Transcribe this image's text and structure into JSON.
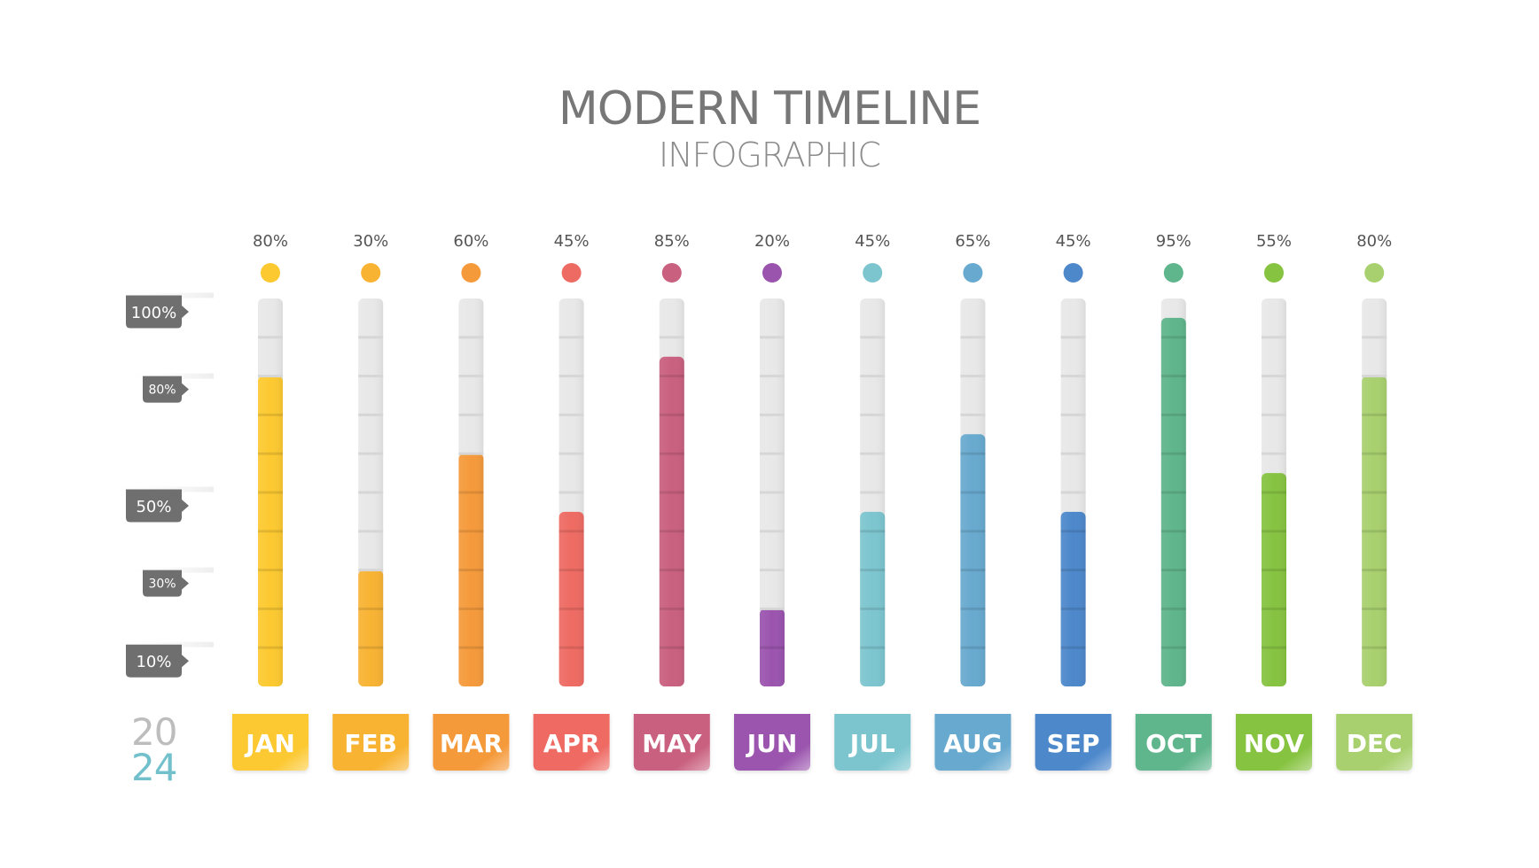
{
  "header": {
    "title": "MODERN TIMELINE",
    "subtitle": "INFOGRAPHIC"
  },
  "year": {
    "top": "20",
    "bottom": "24",
    "top_color": "#bdbdbd",
    "bottom_color": "#72c0cc"
  },
  "chart_data": {
    "type": "bar",
    "title": "MODERN TIMELINE INFOGRAPHIC",
    "xlabel": "",
    "ylabel": "",
    "ylim": [
      0,
      100
    ],
    "grid": true,
    "categories": [
      "JAN",
      "FEB",
      "MAR",
      "APR",
      "MAY",
      "JUN",
      "JUL",
      "AUG",
      "SEP",
      "OCT",
      "NOV",
      "DEC"
    ],
    "values": [
      80,
      30,
      60,
      45,
      85,
      20,
      45,
      65,
      45,
      95,
      55,
      80
    ],
    "value_labels": [
      "80%",
      "30%",
      "60%",
      "45%",
      "85%",
      "20%",
      "45%",
      "65%",
      "45%",
      "95%",
      "55%",
      "80%"
    ],
    "colors": [
      "#fcc930",
      "#f8b333",
      "#f59a3b",
      "#ee6b63",
      "#c9607f",
      "#9b54ae",
      "#7cc5cf",
      "#68a9cf",
      "#4d88cb",
      "#5fb58c",
      "#86c341",
      "#a8d06e"
    ],
    "y_markers": [
      {
        "value": 100,
        "label": "100%"
      },
      {
        "value": 80,
        "label": "80%"
      },
      {
        "value": 50,
        "label": "50%"
      },
      {
        "value": 30,
        "label": "30%"
      },
      {
        "value": 10,
        "label": "10%"
      }
    ]
  },
  "style": {
    "track_color": "#e8e8e8",
    "grid_color": "#d6d6d6",
    "tag_color": "#6f6f6f",
    "title_color": "#777777"
  }
}
